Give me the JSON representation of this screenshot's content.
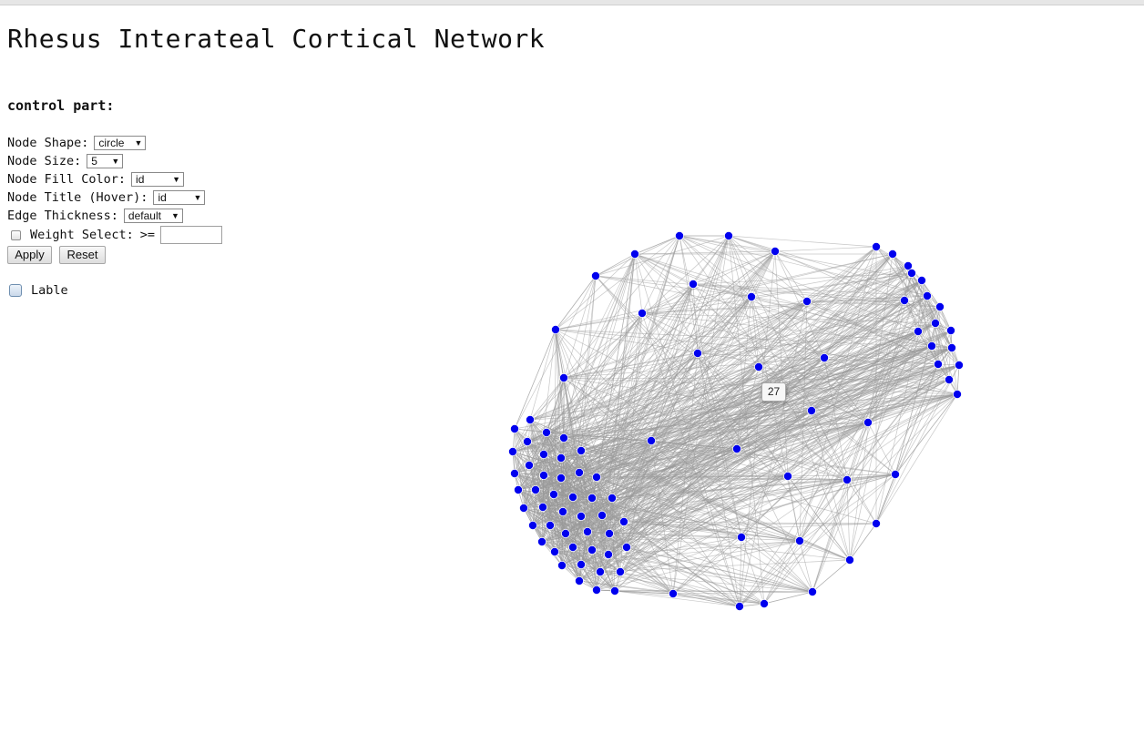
{
  "page": {
    "title": "Rhesus Interateal Cortical Network"
  },
  "controls": {
    "heading": "control part:",
    "node_shape": {
      "label": "Node Shape:",
      "value": "circle"
    },
    "node_size": {
      "label": "Node Size:",
      "value": "5"
    },
    "node_fill_color": {
      "label": "Node Fill Color:",
      "value": "id"
    },
    "node_title": {
      "label": "Node Title (Hover):",
      "value": "id"
    },
    "edge_thickness": {
      "label": "Edge Thickness:",
      "value": "default"
    },
    "weight_select": {
      "label": "Weight Select:",
      "operator": ">=",
      "value": "",
      "checked": false
    },
    "apply_label": "Apply",
    "reset_label": "Reset",
    "lable_checkbox": {
      "label": "Lable",
      "checked": false
    }
  },
  "network": {
    "node_color": "#0000ee",
    "edge_color": "#999999",
    "node_shape": "circle",
    "tooltip": "27"
  }
}
